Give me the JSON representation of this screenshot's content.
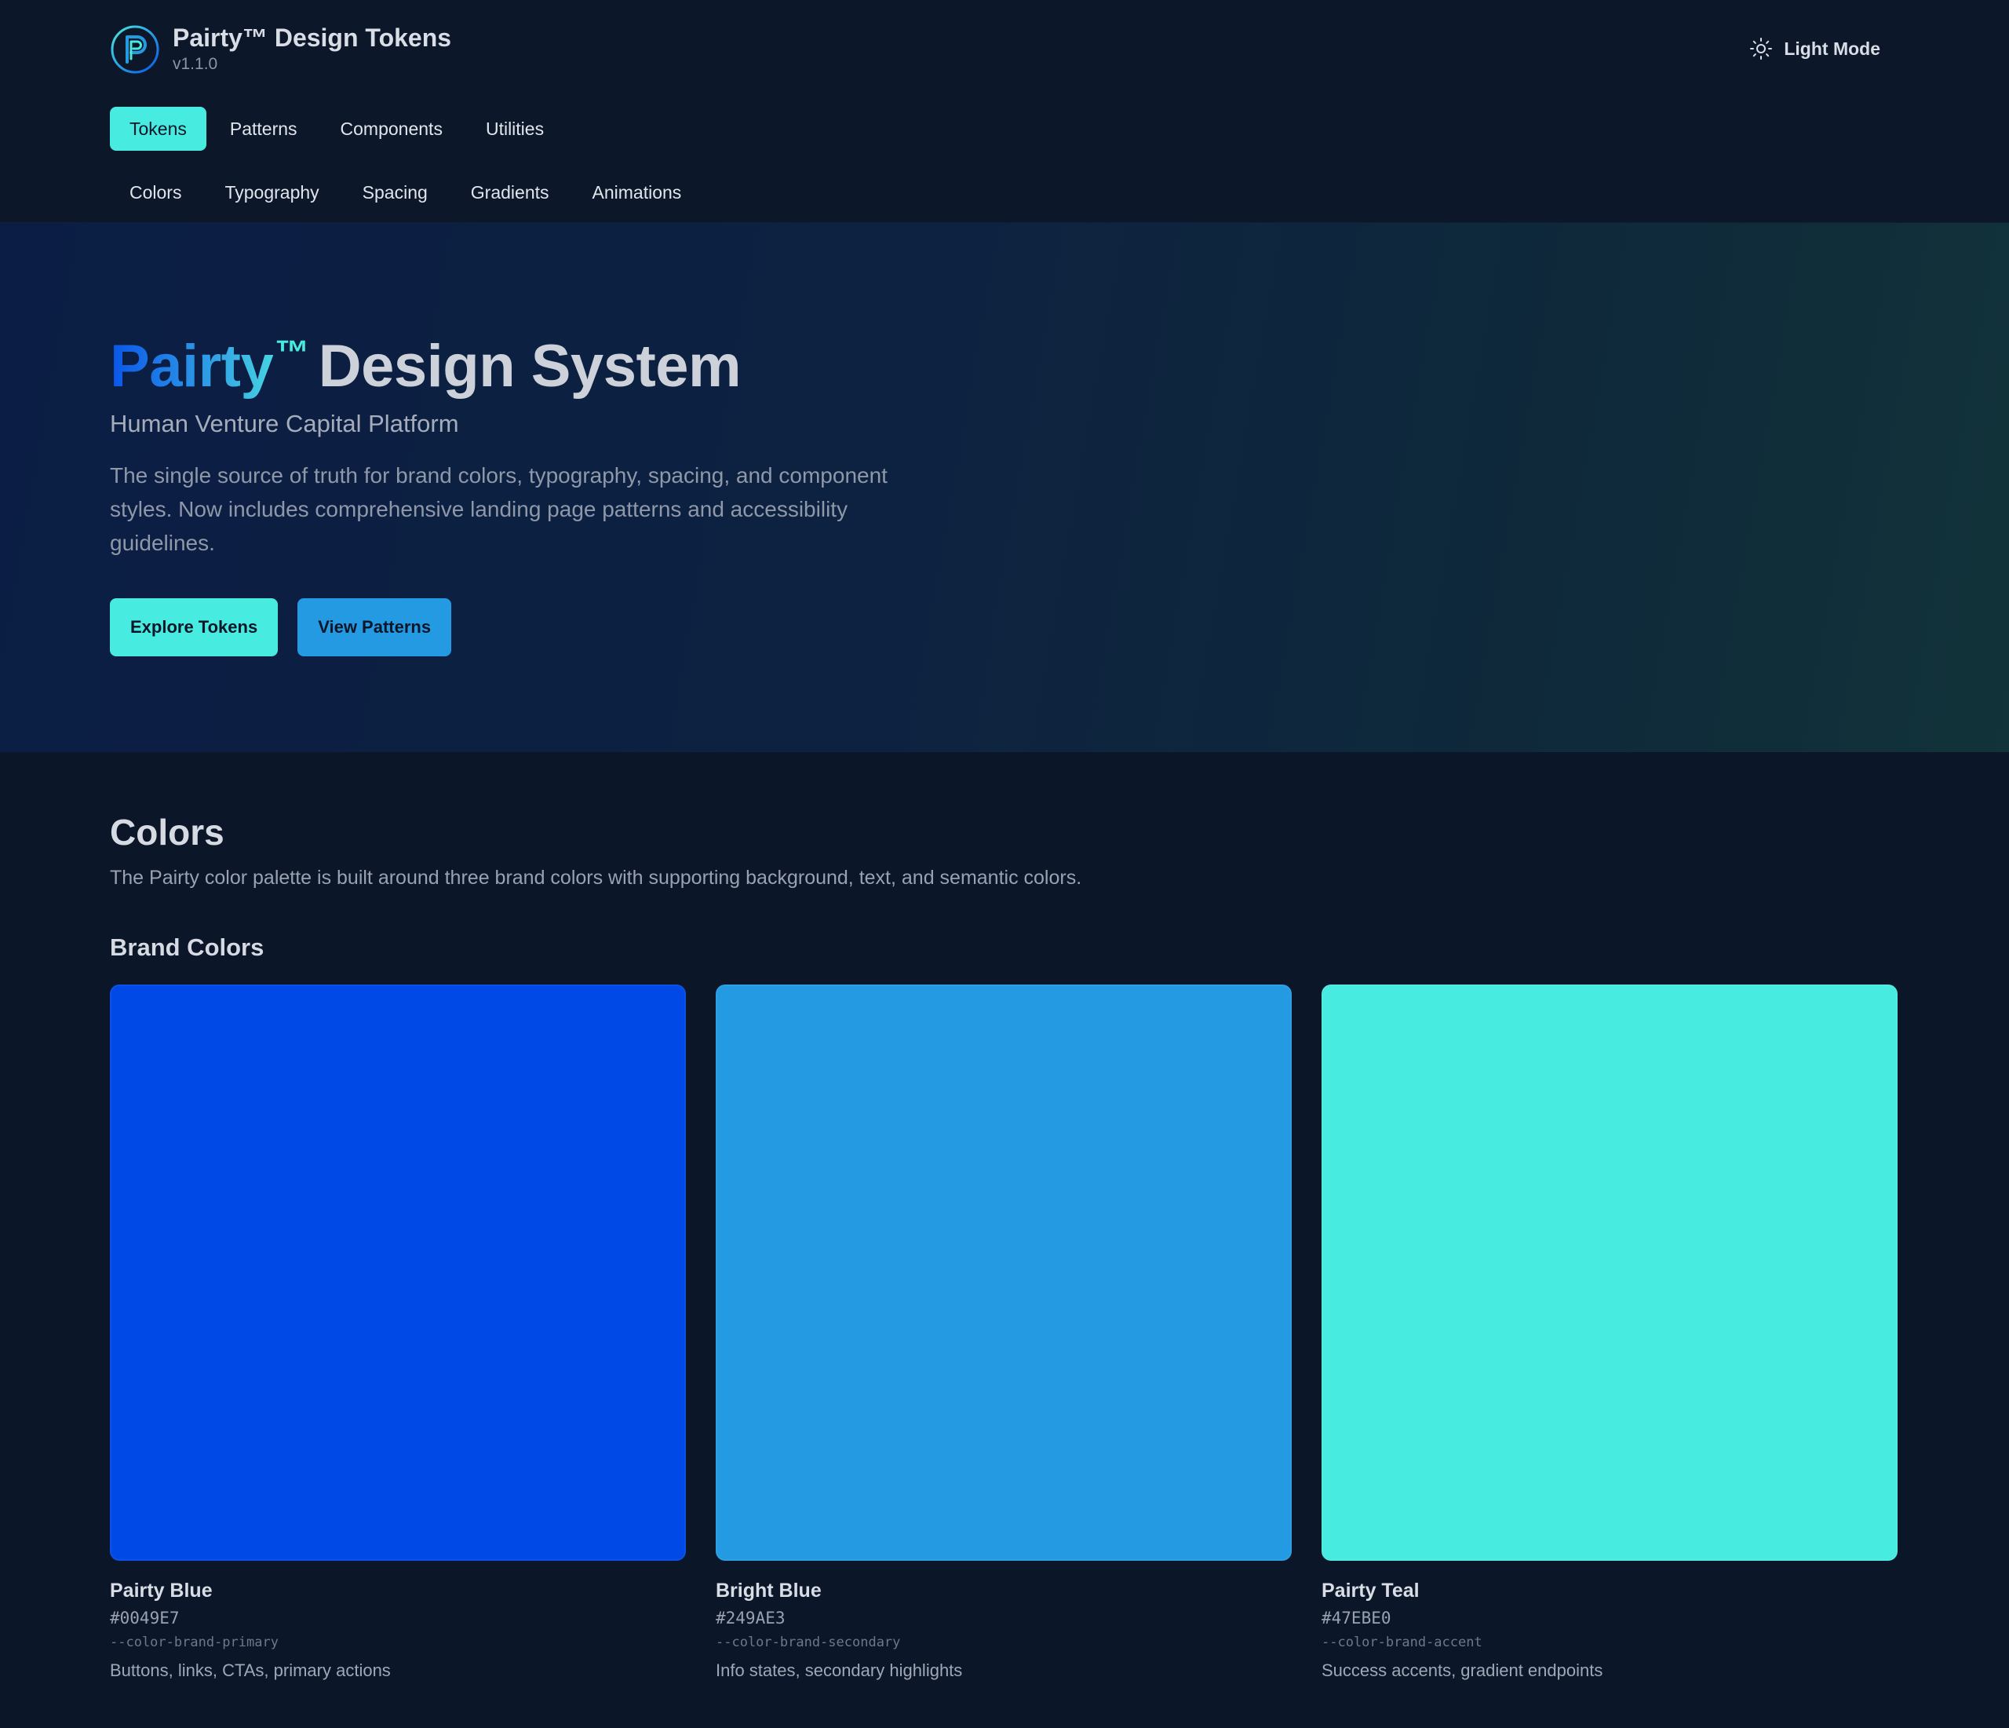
{
  "header": {
    "brand_title": "Pairty™ Design Tokens",
    "version": "v1.1.0",
    "theme_toggle_label": "Light Mode",
    "logo_icon": "pairty-p-logo-icon",
    "theme_icon": "sun-icon"
  },
  "primary_nav": [
    {
      "label": "Tokens",
      "active": true
    },
    {
      "label": "Patterns",
      "active": false
    },
    {
      "label": "Components",
      "active": false
    },
    {
      "label": "Utilities",
      "active": false
    }
  ],
  "secondary_nav": [
    {
      "label": "Colors"
    },
    {
      "label": "Typography"
    },
    {
      "label": "Spacing"
    },
    {
      "label": "Gradients"
    },
    {
      "label": "Animations"
    }
  ],
  "hero": {
    "title_brand": "Pairty",
    "title_tm": "™",
    "title_rest": "Design System",
    "subtitle": "Human Venture Capital Platform",
    "description": "The single source of truth for brand colors, typography, spacing, and component styles. Now includes comprehensive landing page patterns and accessibility guidelines.",
    "primary_button": "Explore Tokens",
    "secondary_button": "View Patterns"
  },
  "colors_section": {
    "title": "Colors",
    "description": "The Pairty color palette is built around three brand colors with supporting background, text, and semantic colors.",
    "brand_colors_title": "Brand Colors",
    "swatches": [
      {
        "name": "Pairty Blue",
        "hex": "#0049E7",
        "var": "--color-brand-primary",
        "usage": "Buttons, links, CTAs, primary actions",
        "color": "#0049E7"
      },
      {
        "name": "Bright Blue",
        "hex": "#249AE3",
        "var": "--color-brand-secondary",
        "usage": "Info states, secondary highlights",
        "color": "#249AE3"
      },
      {
        "name": "Pairty Teal",
        "hex": "#47EBE0",
        "var": "--color-brand-accent",
        "usage": "Success accents, gradient endpoints",
        "color": "#47EBE0"
      }
    ]
  },
  "theme": {
    "background": "#0B1628",
    "accent_teal": "#47EBE0",
    "accent_blue": "#249AE3",
    "brand_blue": "#0049E7"
  }
}
